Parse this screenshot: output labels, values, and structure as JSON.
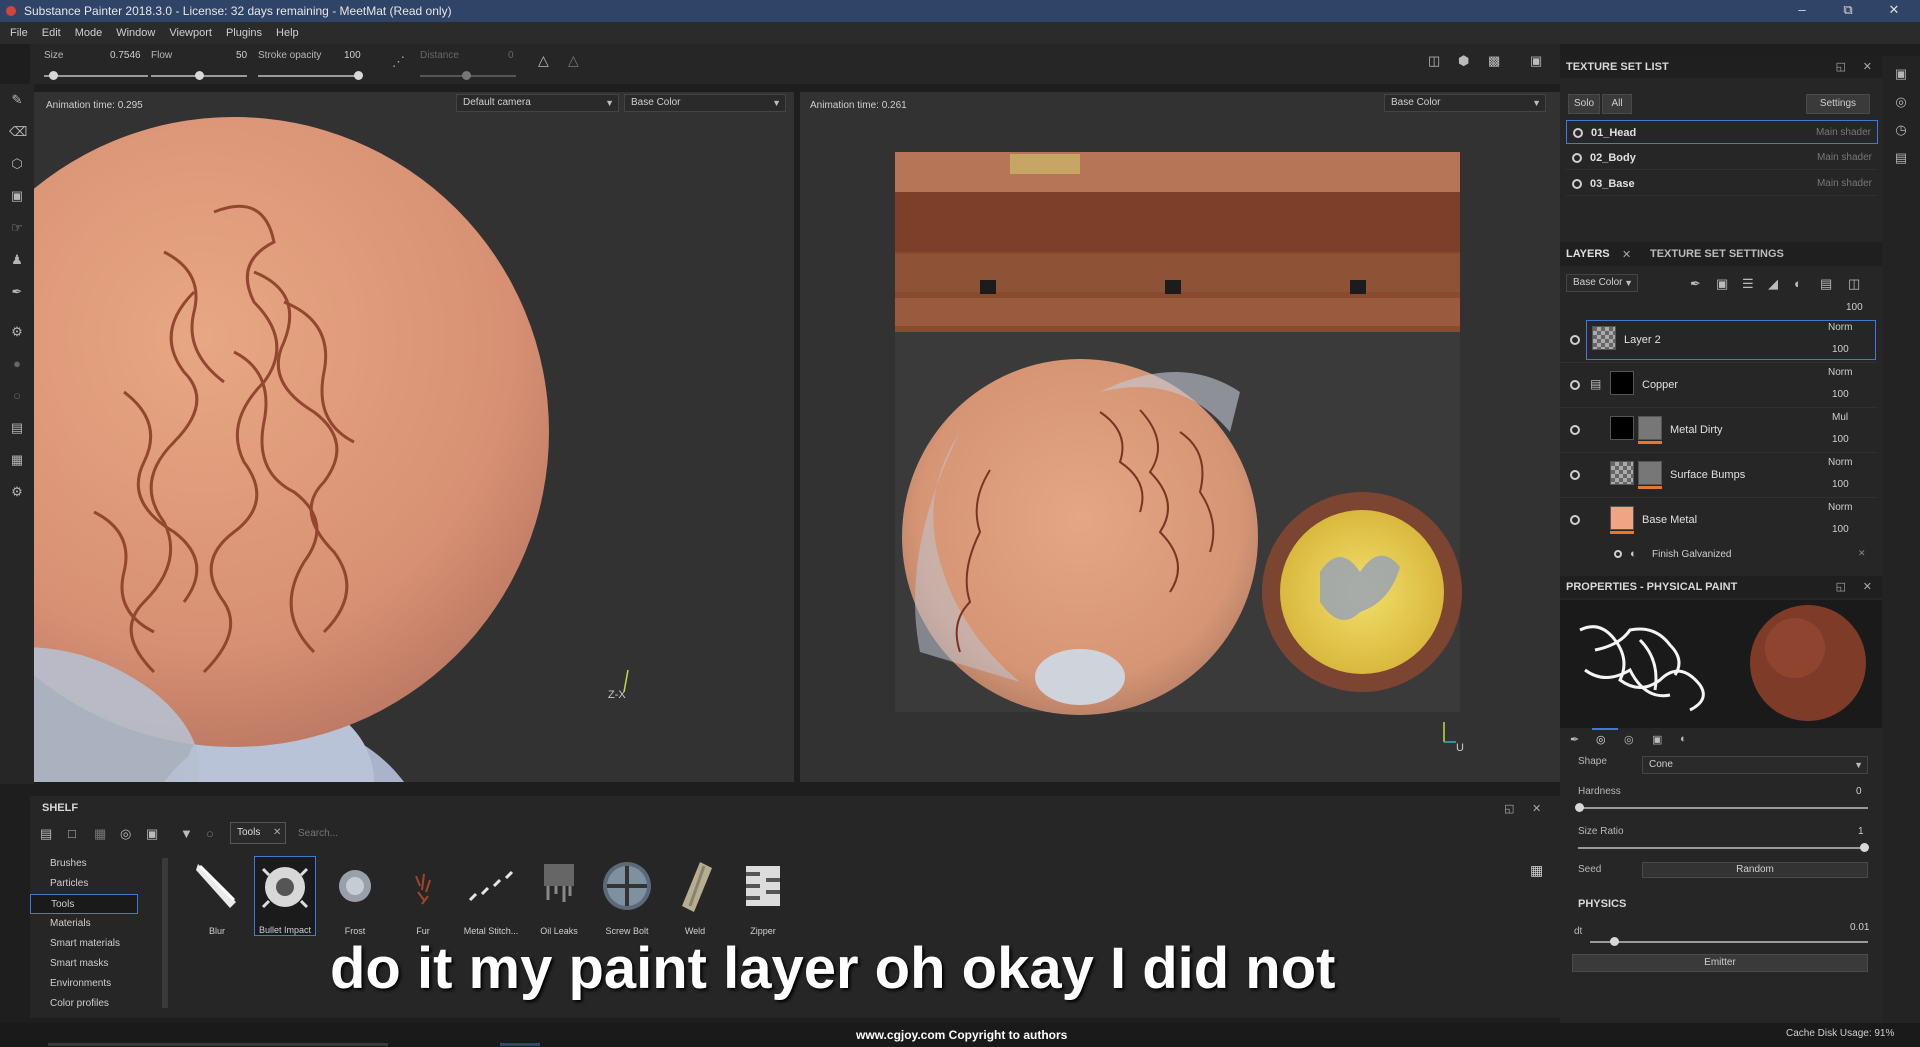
{
  "app": {
    "title": "Substance Painter 2018.3.0 - License: 32 days remaining - MeetMat (Read only)"
  },
  "menu": [
    "File",
    "Edit",
    "Mode",
    "Window",
    "Viewport",
    "Plugins",
    "Help"
  ],
  "tool_params": {
    "size_label": "Size",
    "size_value": "0.7546",
    "flow_label": "Flow",
    "flow_value": "50",
    "opacity_label": "Stroke opacity",
    "opacity_value": "100",
    "distance_label": "Distance",
    "distance_value": "0"
  },
  "viewport3d": {
    "anim_time": "Animation time: 0.295",
    "camera": "Default camera",
    "channel": "Base Color",
    "axis_label": "Z-X"
  },
  "viewport2d": {
    "anim_time": "Animation time: 0.261",
    "channel": "Base Color",
    "axis_label": "U"
  },
  "texture_set_list": {
    "title": "TEXTURE SET LIST",
    "solo": "Solo",
    "all": "All",
    "settings": "Settings",
    "sets": [
      {
        "name": "01_Head",
        "shader": "Main shader"
      },
      {
        "name": "02_Body",
        "shader": "Main shader"
      },
      {
        "name": "03_Base",
        "shader": "Main shader"
      }
    ]
  },
  "layers_panel": {
    "tab_layers": "LAYERS",
    "tab_settings": "TEXTURE SET SETTINGS",
    "channel": "Base Color",
    "top_opacity": "100",
    "layers": [
      {
        "name": "Layer 2",
        "blend": "Norm",
        "opacity": "100"
      },
      {
        "name": "Copper",
        "blend": "Norm",
        "opacity": "100"
      },
      {
        "name": "Metal Dirty",
        "blend": "Mul",
        "opacity": "100"
      },
      {
        "name": "Surface Bumps",
        "blend": "Norm",
        "opacity": "100"
      },
      {
        "name": "Base Metal",
        "blend": "Norm",
        "opacity": "100"
      }
    ],
    "effect": "Finish Galvanized"
  },
  "properties": {
    "title": "PROPERTIES - PHYSICAL PAINT",
    "shape_label": "Shape",
    "shape_value": "Cone",
    "hardness_label": "Hardness",
    "hardness_value": "0",
    "size_ratio_label": "Size Ratio",
    "size_ratio_value": "1",
    "seed_label": "Seed",
    "seed_value": "Random",
    "physics_label": "PHYSICS",
    "dt_label": "dt",
    "dt_value": "0.01",
    "emitter": "Emitter"
  },
  "shelf": {
    "title": "SHELF",
    "tab": "Tools",
    "search_placeholder": "Search...",
    "categories": [
      "Brushes",
      "Particles",
      "Tools",
      "Materials",
      "Smart materials",
      "Smart masks",
      "Environments",
      "Color profiles"
    ],
    "selected_category": "Tools",
    "items": [
      "Blur",
      "Bullet Impact",
      "Frost",
      "Fur",
      "Metal Stitch...",
      "Oil Leaks",
      "Screw Bolt",
      "Weld",
      "Zipper"
    ]
  },
  "caption": "do it my paint layer oh okay I did not",
  "status": {
    "copyright": "www.cgjoy.com Copyright to authors",
    "cache": "Cache Disk Usage: 91%"
  },
  "colors": {
    "titlebar": "#2f4466",
    "selection": "#3d7bd4",
    "copper": "#e2a07a",
    "orange_mask": "#e8772e"
  }
}
